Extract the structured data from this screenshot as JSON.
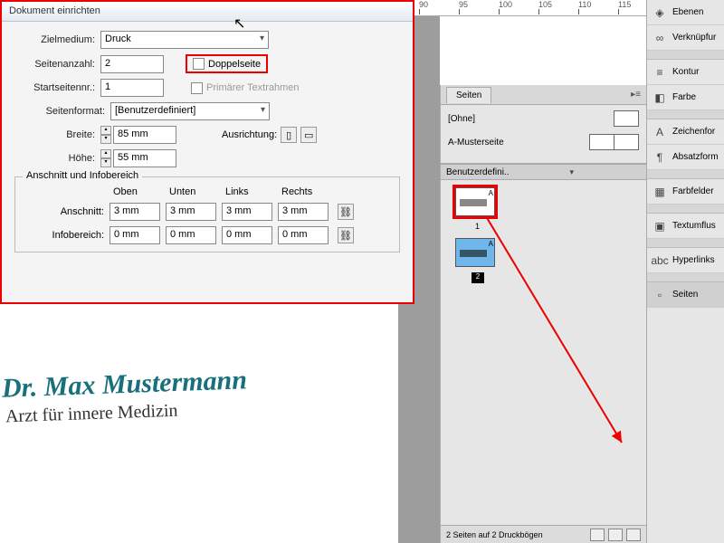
{
  "ruler": {
    "ticks": [
      "90",
      "95",
      "100",
      "105",
      "110",
      "115"
    ]
  },
  "dialog": {
    "title": "Dokument einrichten",
    "zielmedium_label": "Zielmedium:",
    "zielmedium_value": "Druck",
    "seitenanzahl_label": "Seitenanzahl:",
    "seitenanzahl_value": "2",
    "doppelseite_label": "Doppelseite",
    "startseite_label": "Startseitennr.:",
    "startseite_value": "1",
    "textrahmen_label": "Primärer Textrahmen",
    "seitenformat_label": "Seitenformat:",
    "seitenformat_value": "[Benutzerdefiniert]",
    "breite_label": "Breite:",
    "breite_value": "85 mm",
    "hoehe_label": "Höhe:",
    "hoehe_value": "55 mm",
    "ausrichtung_label": "Ausrichtung:",
    "bleed_group": "Anschnitt und Infobereich",
    "col_oben": "Oben",
    "col_unten": "Unten",
    "col_links": "Links",
    "col_rechts": "Rechts",
    "anschnitt_label": "Anschnitt:",
    "anschnitt": [
      "3 mm",
      "3 mm",
      "3 mm",
      "3 mm"
    ],
    "infobereich_label": "Infobereich:",
    "infobereich": [
      "0 mm",
      "0 mm",
      "0 mm",
      "0 mm"
    ]
  },
  "doc": {
    "headline": "Dr. Max Mustermann",
    "subline": "Arzt für innere Medizin"
  },
  "pages_panel": {
    "tab": "Seiten",
    "none": "[Ohne]",
    "master": "A-Musterseite",
    "selector": "Benutzerdefini..",
    "page1_letter": "A",
    "page1_num": "1",
    "page2_letter": "A",
    "page2_num": "2",
    "status": "2 Seiten auf 2 Druckbögen"
  },
  "right": {
    "ebenen": "Ebenen",
    "verknuepfungen": "Verknüpfur",
    "kontur": "Kontur",
    "farbe": "Farbe",
    "zeichen": "Zeichenfor",
    "absatz": "Absatzform",
    "farbfelder": "Farbfelder",
    "textumfluss": "Textumflus",
    "hyperlinks": "Hyperlinks",
    "seiten": "Seiten"
  }
}
